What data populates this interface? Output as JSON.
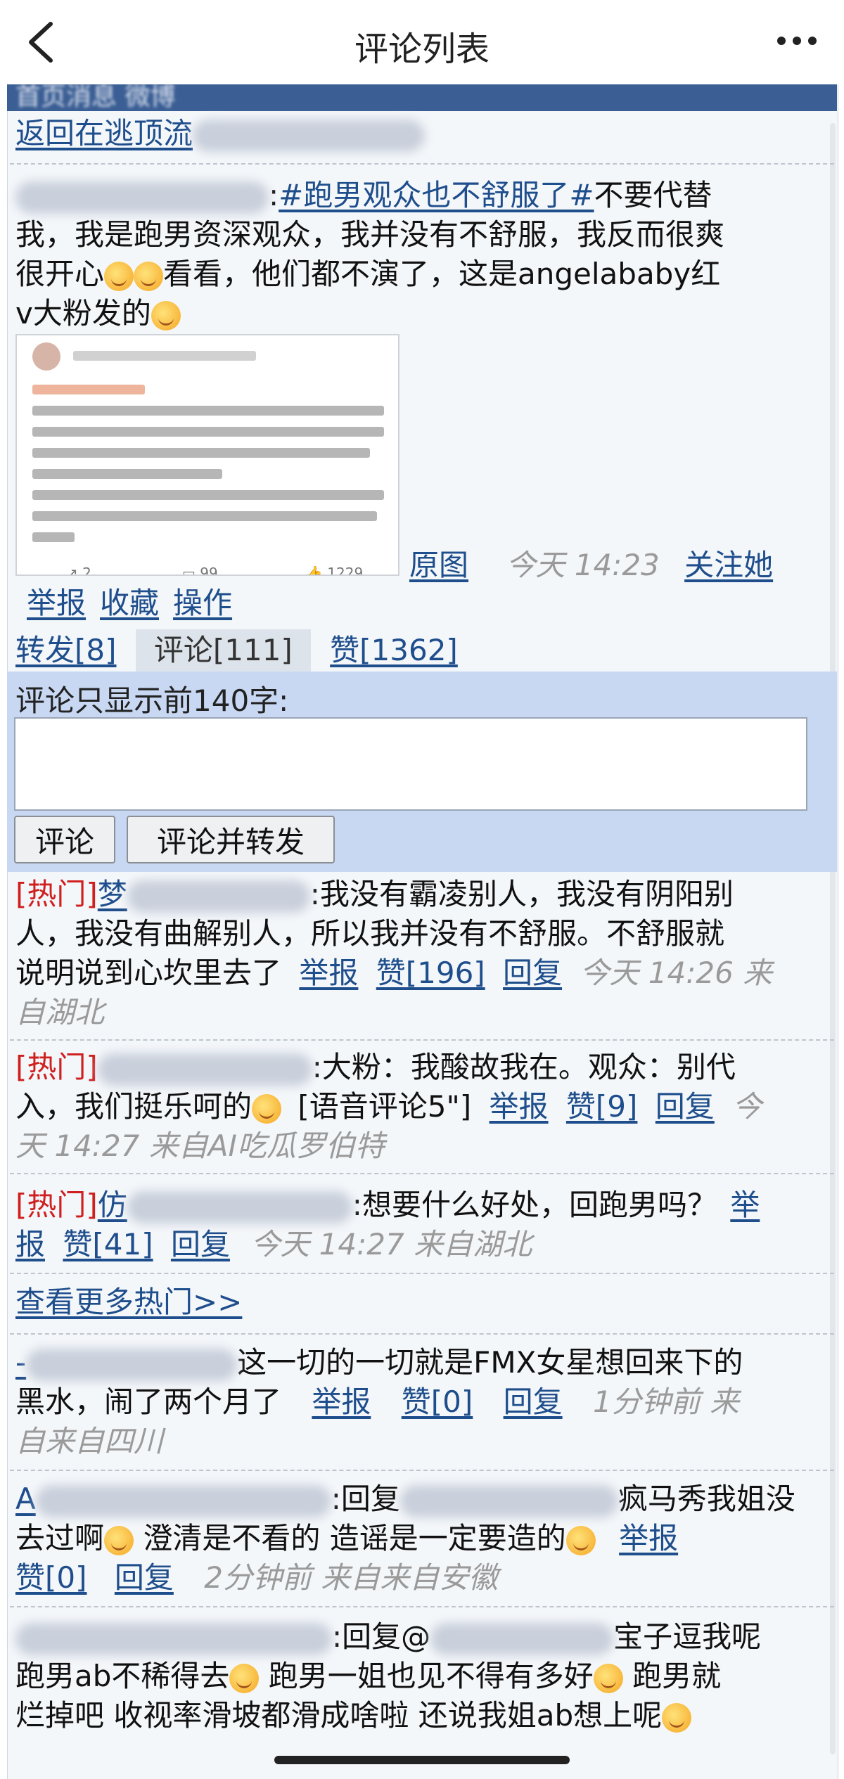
{
  "nav": {
    "title": "评论列表"
  },
  "header": {
    "strip_text": "首页消息 微博",
    "back_link": "返回在逃顶流"
  },
  "post": {
    "topic": "#跑男观众也不舒服了#",
    "line1_rest": "不要代替",
    "line2": "我，我是跑男资深观众，我并没有不舒服，我反而很爽",
    "line3_a": "很开心",
    "line3_b": "看看，他们都不演了，这是angelababy红",
    "line4": "v大粉发的",
    "image_stats": {
      "repost": "2",
      "comment": "99",
      "like": "1229"
    },
    "original_link": "原图",
    "time": "今天 14:23",
    "follow": "关注她",
    "report": "举报",
    "favorite": "收藏",
    "operate": "操作"
  },
  "tabs": {
    "repost": "转发[8]",
    "comment": "评论[111]",
    "like": "赞[1362]"
  },
  "comment_form": {
    "label": "评论只显示前140字:",
    "submit": "评论",
    "submit_repost": "评论并转发"
  },
  "hot_comments": [
    {
      "tag": "[热门]",
      "user_prefix": "梦",
      "text_a": ":我没有霸凌别人，我没有阴阳别",
      "text_b": "人，我没有曲解别人，所以我并没有不舒服。不舒服就",
      "text_c": "说明说到心坎里去了",
      "report": "举报",
      "like": "赞[196]",
      "reply": "回复",
      "meta_a": "今天 14:26 来",
      "meta_b": "自湖北"
    },
    {
      "tag": "[热门]",
      "text_a": ":大粉：我酸故我在。观众：别代",
      "text_b": "入，我们挺乐呵的",
      "text_c": "[语音评论5\"]",
      "report": "举报",
      "like": "赞[9]",
      "reply": "回复",
      "meta_a": "今",
      "meta_b": "天 14:27 来自AI吃瓜罗伯特"
    },
    {
      "tag": "[热门]",
      "user_prefix": "仿",
      "text_a": ":想要什么好处，回跑男吗？",
      "report_a": "举",
      "report_b": "报",
      "like": "赞[41]",
      "reply": "回复",
      "meta": "今天 14:27 来自湖北"
    }
  ],
  "more_hot": "查看更多热门>>",
  "comments": [
    {
      "user_prefix": "-",
      "text_a": "这一切的一切就是FMX女星想回来下的",
      "text_b": "黑水，闹了两个月了",
      "report": "举报",
      "like": "赞[0]",
      "reply": "回复",
      "meta_a": "1分钟前 来",
      "meta_b": "自来自四川"
    },
    {
      "user_prefix": "A",
      "reply_prefix": ":回复",
      "text_a": "疯马秀我姐没",
      "text_b_a": "去过啊",
      "text_b_b": "澄清是不看的 造谣是一定要造的",
      "report": "举报",
      "like": "赞[0]",
      "reply": "回复",
      "meta": "2分钟前 来自来自安徽"
    },
    {
      "reply_prefix": ":回复@",
      "text_a": "宝子逗我呢",
      "text_b_a": "跑男ab不稀得去",
      "text_b_b": "跑男一姐也见不得有多好",
      "text_b_c": "跑男就",
      "text_c": "烂掉吧 收视率滑坡都滑成啥啦 还说我姐ab想上呢"
    }
  ]
}
